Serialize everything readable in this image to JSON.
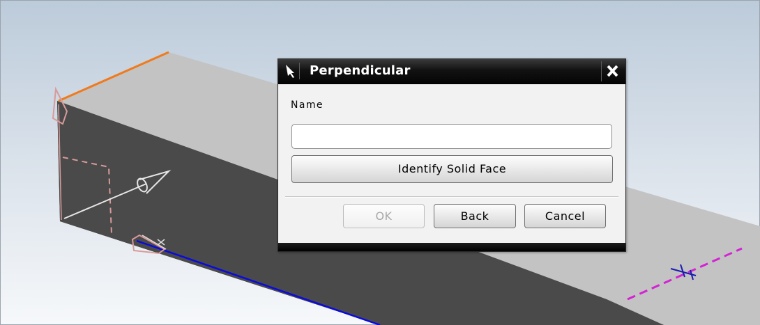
{
  "dialog": {
    "title": "Perpendicular",
    "title_icon": "pointer-arrow-icon",
    "close_icon": "close-icon",
    "name_label": "Name",
    "name_value": "",
    "identify_button": "Identify Solid Face",
    "ok_button": "OK",
    "ok_enabled": false,
    "back_button": "Back",
    "cancel_button": "Cancel"
  },
  "viewport": {
    "background_color": "#c9d5e1",
    "solid_top_color": "#c2c2c2",
    "solid_side_color": "#4b4b4b",
    "edge_highlight_color": "#f07a1c",
    "edge_selected_color": "#0a0adf",
    "datum_color": "#d89a9a",
    "cut_line_color": "#d422d4",
    "marker_color": "#1a1ab0"
  }
}
